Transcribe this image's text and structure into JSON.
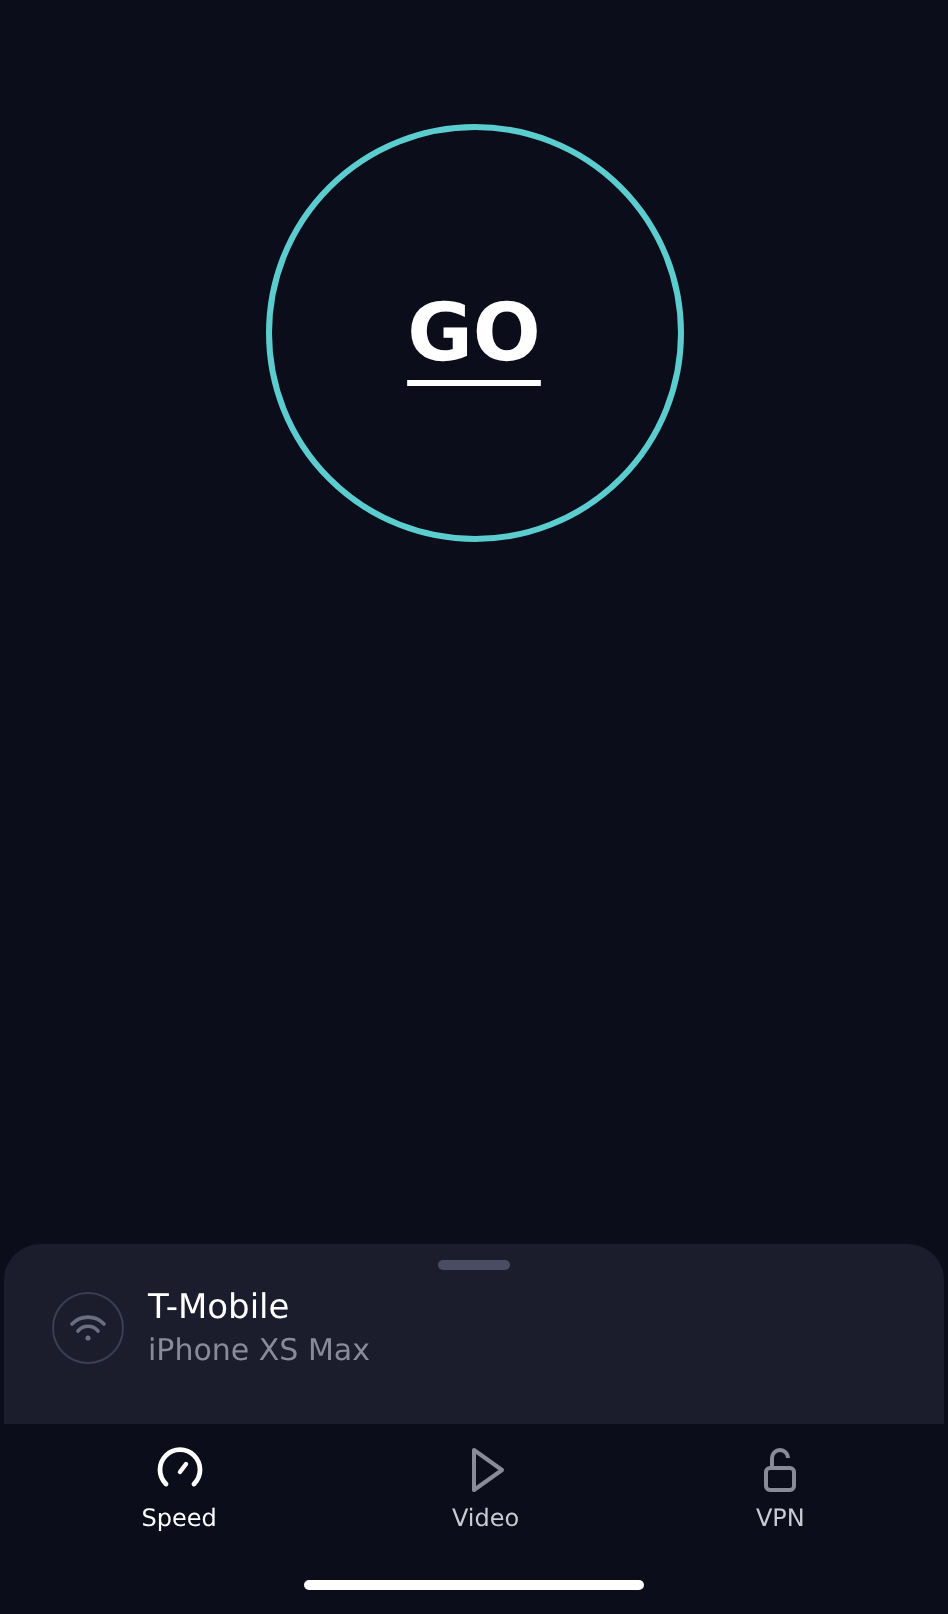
{
  "go_button": {
    "label": "GO"
  },
  "network": {
    "name": "T-Mobile",
    "device": "iPhone XS Max"
  },
  "tabs": [
    {
      "label": "Speed",
      "kind": "speed",
      "selected": true
    },
    {
      "label": "Video",
      "kind": "video",
      "selected": false
    },
    {
      "label": "VPN",
      "kind": "vpn",
      "selected": false
    }
  ]
}
